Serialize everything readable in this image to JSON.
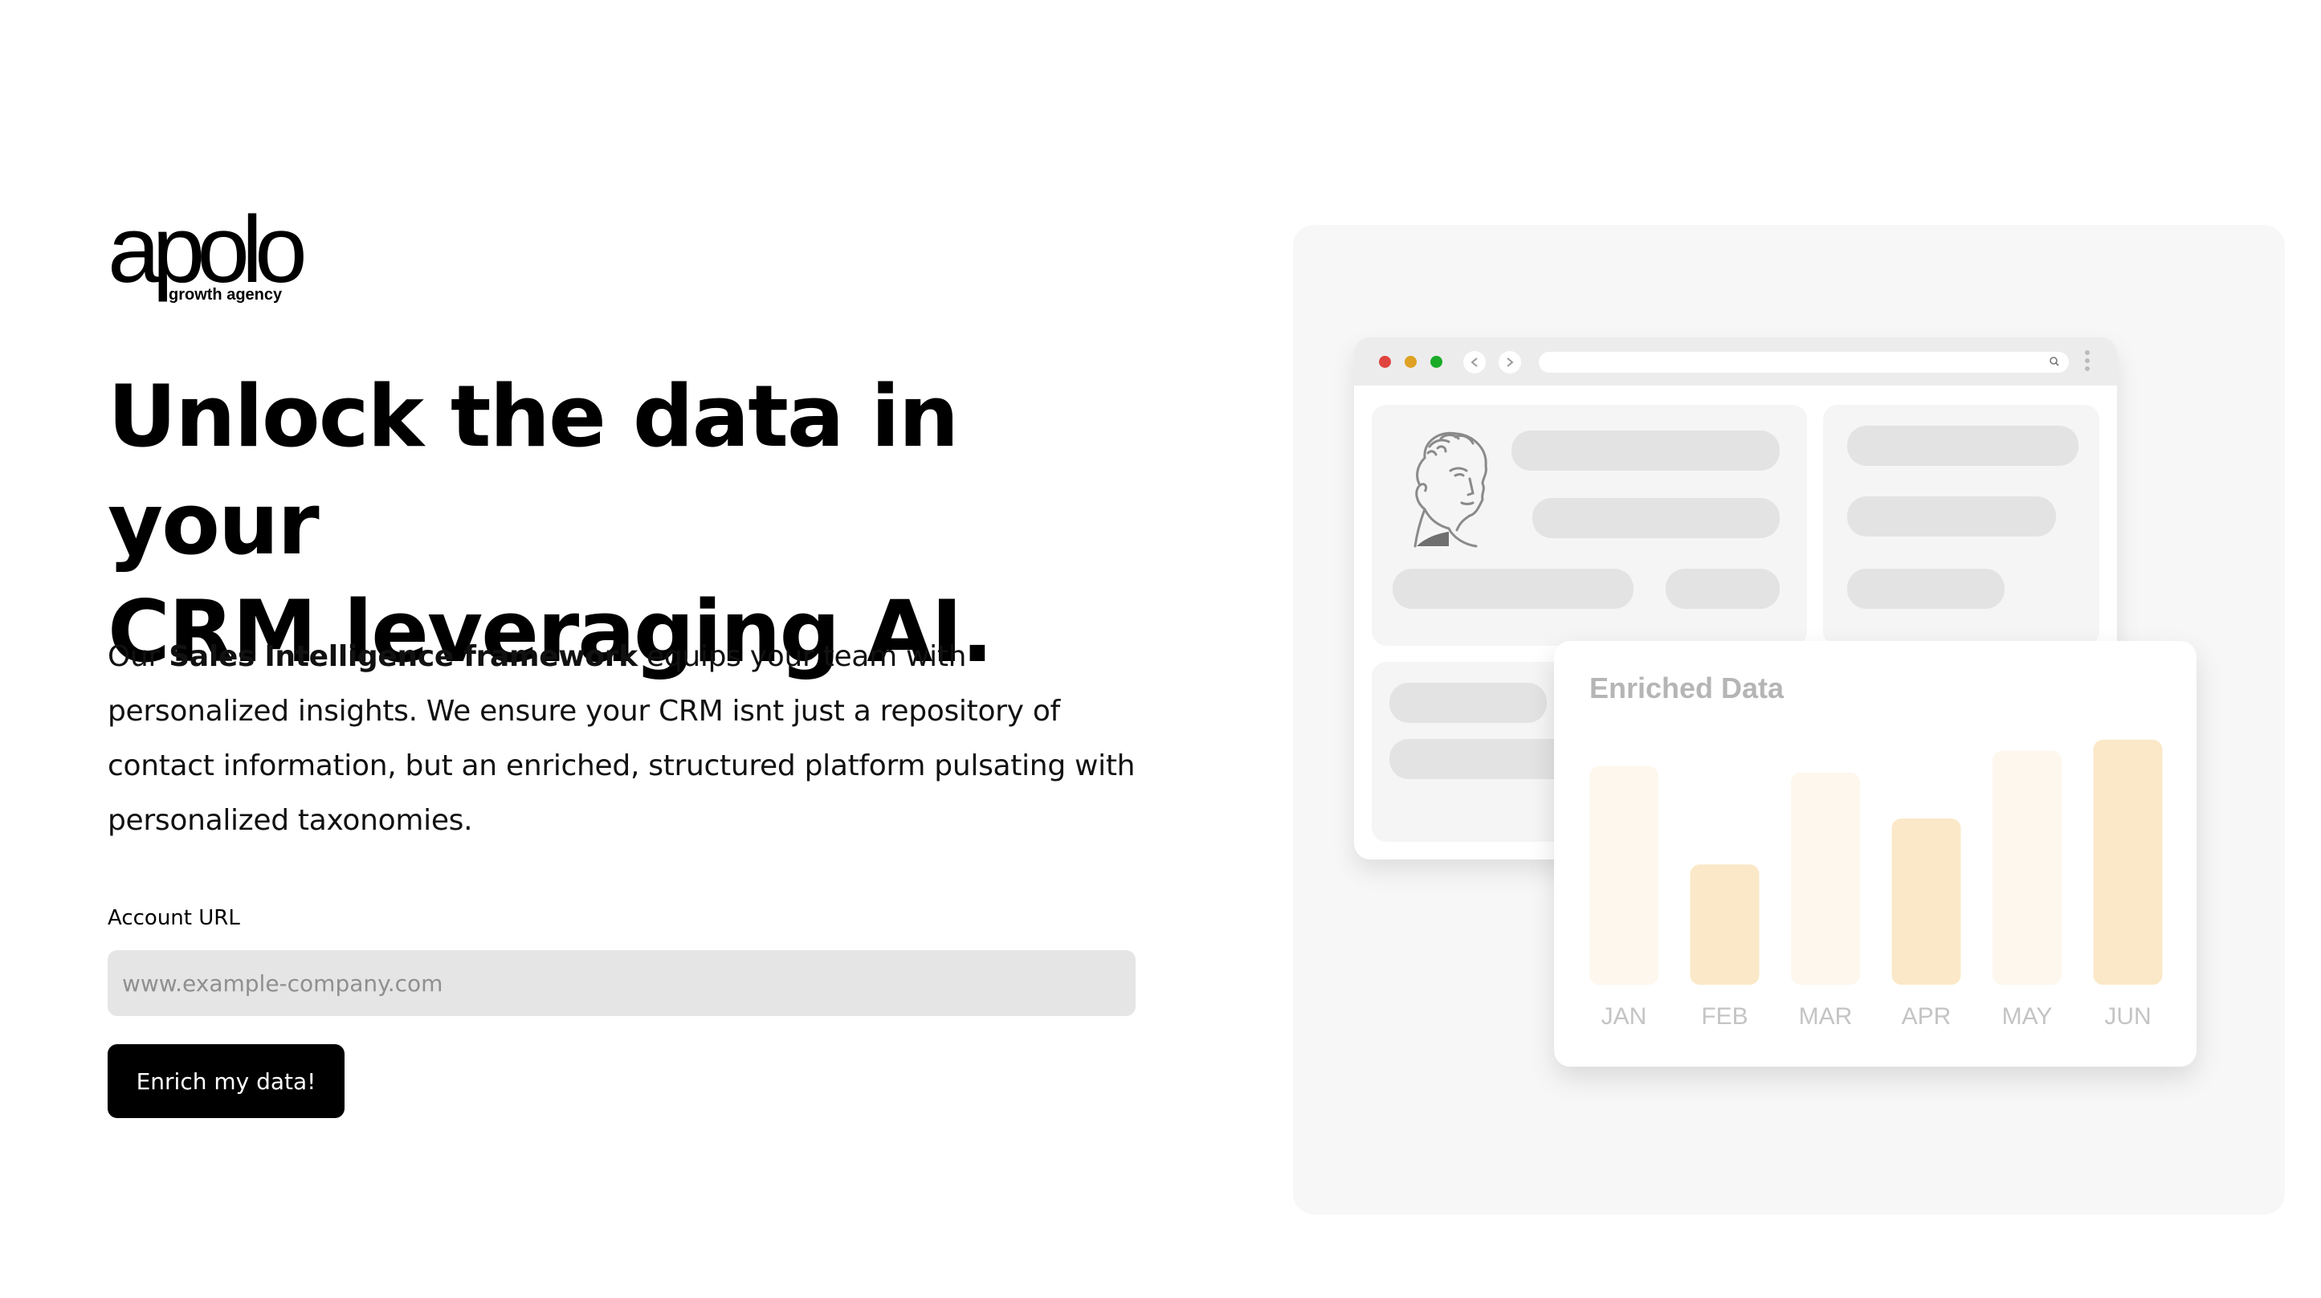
{
  "logo": {
    "wordmark": "apolo",
    "tagline": "growth agency"
  },
  "hero": {
    "headline_line1": "Unlock the data in your",
    "headline_line2": "CRM leveraging AI.",
    "intro_prefix": "Our ",
    "intro_bold": "Sales Intelligence framework",
    "intro_suffix": " equips your team with personalized insights. We ensure your CRM isnt just a repository of contact information, but an enriched, structured platform pulsating with personalized taxonomies."
  },
  "form": {
    "field_label": "Account URL",
    "url_placeholder": "www.example-company.com",
    "url_value": "",
    "submit_label": "Enrich my data!"
  },
  "illustration": {
    "window_dot_colors": [
      "#e0443e",
      "#dfa123",
      "#1aab29"
    ],
    "nav_back_icon": "arrow-left-icon",
    "nav_forward_icon": "arrow-right-icon",
    "search_icon": "magnifier-icon",
    "menu_icon": "kebab-menu-icon",
    "portrait_icon": "classical-bust-icon"
  },
  "chart_data": {
    "type": "bar",
    "title": "Enriched Data",
    "categories": [
      "JAN",
      "FEB",
      "MAR",
      "APR",
      "MAY",
      "JUN"
    ],
    "values": [
      1.0,
      0.55,
      0.97,
      0.76,
      1.07,
      1.12
    ],
    "bar_colors": [
      "#fdf7ee",
      "#fbe8c8",
      "#fdf7ee",
      "#fbe8c8",
      "#fdf7ee",
      "#fbe8c8"
    ],
    "ylim": [
      0,
      1.12
    ],
    "grid": false,
    "legend": "none"
  }
}
